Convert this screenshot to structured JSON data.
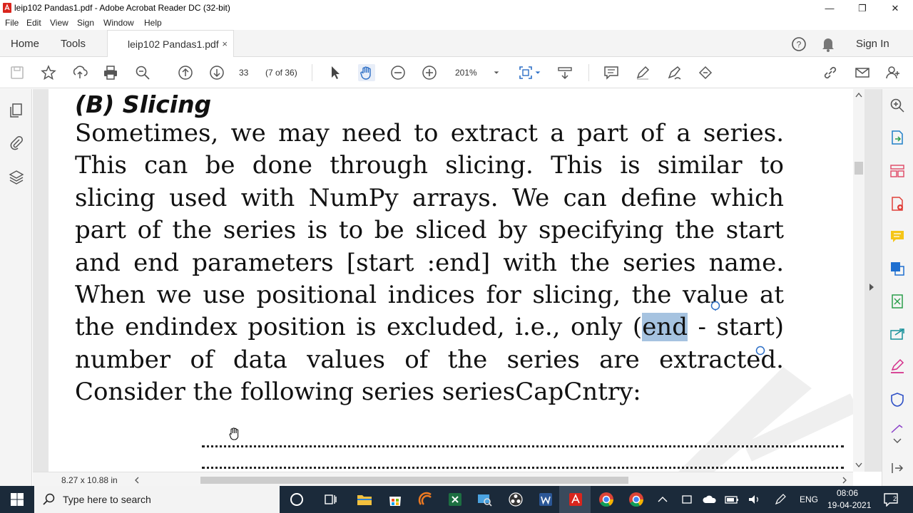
{
  "window": {
    "title": "leip102 Pandas1.pdf - Adobe Acrobat Reader DC (32-bit)",
    "controls": {
      "minimize": "—",
      "maximize": "❐",
      "close": "✕"
    }
  },
  "menu": [
    "File",
    "Edit",
    "View",
    "Sign",
    "Window",
    "Help"
  ],
  "tabs": {
    "home": "Home",
    "tools": "Tools",
    "document": "leip102 Pandas1.pdf",
    "close": "×",
    "sign_in": "Sign In"
  },
  "toolbar": {
    "page_number": "33",
    "page_of": "(7 of 36)",
    "zoom": "201%"
  },
  "document": {
    "heading": "(B)  Slicing",
    "para_before": "Sometimes, we may need to extract a part of a series. This can be done through slicing. This is similar to slicing used with NumPy arrays. We can define which part of the series is to be sliced by specifying the start and end parameters [start :end] with the series name. When we use positional indices for slicing, the value at the endindex position is excluded, i.e., only (",
    "selected_text": "end",
    "para_after": " - start) number of data values of the series are extracted. Consider the following series seriesCapCntry:",
    "page_size": "8.27 x 10.88 in"
  },
  "taskbar": {
    "search_placeholder": "Type here to search",
    "language": "ENG",
    "time": "08:06",
    "date": "19-04-2021"
  },
  "colors": {
    "selection": "#a6c3e0",
    "taskbar": "#1b2a3a",
    "acrobat_red": "#d9251d"
  }
}
